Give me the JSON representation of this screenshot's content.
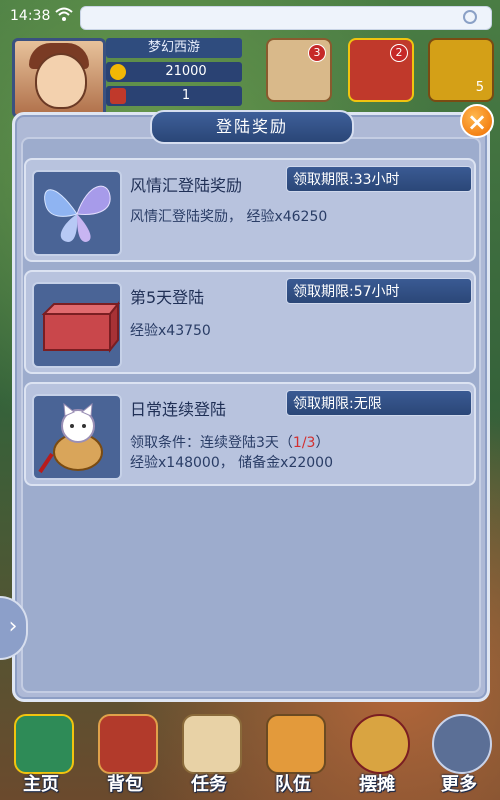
{
  "status_bar": {
    "time": "14:38"
  },
  "hud": {
    "player_name": "梦幻西游",
    "gold": "21000",
    "item_count": "1",
    "badges": [
      "3",
      "2"
    ],
    "corner_count": "5"
  },
  "dialog": {
    "title": "登陆奖励",
    "rewards": [
      {
        "title": "风情汇登陆奖励",
        "deadline": "领取期限:33小时",
        "desc1": "风情汇登陆奖励， 经验x46250",
        "icon": "butterfly-icon"
      },
      {
        "title": "第5天登陆",
        "deadline": "领取期限:57小时",
        "desc1": "经验x43750",
        "icon": "red-box-icon"
      },
      {
        "title": "日常连续登陆",
        "deadline": "领取期限:无限",
        "desc1_prefix": "领取条件：连续登陆3天（",
        "desc1_progress": "1/3",
        "desc1_suffix": "）",
        "desc2": "经验x148000， 储备金x22000",
        "icon": "lucky-cat-icon"
      }
    ]
  },
  "nav": [
    {
      "label": "主页",
      "icon": "home-icon"
    },
    {
      "label": "背包",
      "icon": "backpack-icon"
    },
    {
      "label": "任务",
      "icon": "quest-scroll-icon"
    },
    {
      "label": "队伍",
      "icon": "team-icon"
    },
    {
      "label": "摆摊",
      "icon": "stall-icon"
    },
    {
      "label": "更多",
      "icon": "more-icon"
    }
  ],
  "colors": {
    "panel_blue": "#2b4778",
    "dialog_bg": "#aeb9d6",
    "close_orange": "#ef6c00",
    "progress_red": "#d32f2f"
  }
}
